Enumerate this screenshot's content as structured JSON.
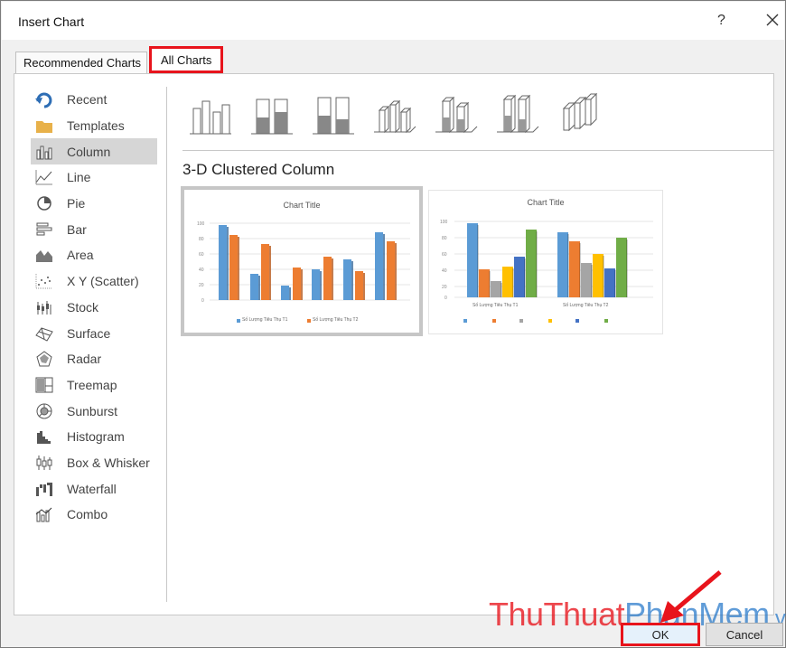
{
  "dialog": {
    "title": "Insert Chart",
    "help": "?"
  },
  "tabs": {
    "recommended": "Recommended Charts",
    "all": "All Charts"
  },
  "sidebar": {
    "items": [
      {
        "label": "Recent",
        "icon": "recent-icon"
      },
      {
        "label": "Templates",
        "icon": "templates-icon"
      },
      {
        "label": "Column",
        "icon": "column-icon"
      },
      {
        "label": "Line",
        "icon": "line-icon"
      },
      {
        "label": "Pie",
        "icon": "pie-icon"
      },
      {
        "label": "Bar",
        "icon": "bar-icon"
      },
      {
        "label": "Area",
        "icon": "area-icon"
      },
      {
        "label": "X Y (Scatter)",
        "icon": "scatter-icon"
      },
      {
        "label": "Stock",
        "icon": "stock-icon"
      },
      {
        "label": "Surface",
        "icon": "surface-icon"
      },
      {
        "label": "Radar",
        "icon": "radar-icon"
      },
      {
        "label": "Treemap",
        "icon": "treemap-icon"
      },
      {
        "label": "Sunburst",
        "icon": "sunburst-icon"
      },
      {
        "label": "Histogram",
        "icon": "histogram-icon"
      },
      {
        "label": "Box & Whisker",
        "icon": "box-whisker-icon"
      },
      {
        "label": "Waterfall",
        "icon": "waterfall-icon"
      },
      {
        "label": "Combo",
        "icon": "combo-icon"
      }
    ],
    "selected": "Column"
  },
  "selected_subtype": "3-D Clustered Column",
  "previews": [
    {
      "title": "Chart Title",
      "series": [
        "Số Lượng Tiêu Thụ T1",
        "Số Lượng Tiêu Thụ T2"
      ]
    },
    {
      "title": "Chart Title",
      "categories": [
        "Số Lượng Tiêu Thụ T1",
        "Số Lượng Tiêu Thụ T2"
      ]
    }
  ],
  "buttons": {
    "ok": "OK",
    "cancel": "Cancel"
  },
  "watermark": {
    "part1": "ThuThuat",
    "part2": "PhanMem",
    "part3": ".vn"
  },
  "colors": {
    "highlight": "#e8141c",
    "blue": "#5b9bd5",
    "orange": "#ed7d31",
    "gray": "#a5a5a5",
    "yellow": "#ffc000",
    "darkblue": "#4472c4",
    "green": "#70ad47"
  }
}
